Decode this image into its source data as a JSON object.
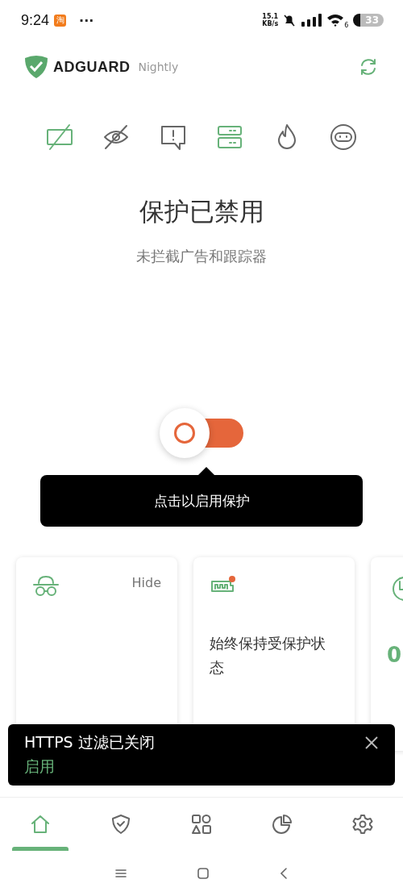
{
  "status_bar": {
    "time": "9:24",
    "app_badge": "淘",
    "more": "···",
    "speed_value": "15.1",
    "speed_unit": "KB/s",
    "wifi_band": "6",
    "battery": "33"
  },
  "header": {
    "brand": "ADGUARD",
    "edition": "Nightly"
  },
  "feature_icons": [
    {
      "kind": "ads",
      "on": true
    },
    {
      "kind": "tracking",
      "on": false
    },
    {
      "kind": "annoyance",
      "on": false
    },
    {
      "kind": "dns",
      "on": true
    },
    {
      "kind": "firewall",
      "on": false
    },
    {
      "kind": "stealth",
      "on": false
    }
  ],
  "status": {
    "title": "保护已禁用",
    "subtitle": "未拦截广告和跟踪器"
  },
  "protection_toggle": {
    "on": false
  },
  "tooltip": {
    "text": "点击以启用保护"
  },
  "cards": [
    {
      "kind": "stealth",
      "action": "Hide"
    },
    {
      "kind": "battery",
      "text": "始终保持受保护状态"
    },
    {
      "kind": "stats",
      "value": "0"
    }
  ],
  "snackbar": {
    "message": "HTTPS 过滤已关闭",
    "action": "启用"
  },
  "bottom_nav": [
    {
      "kind": "home",
      "selected": true
    },
    {
      "kind": "protection",
      "selected": false
    },
    {
      "kind": "apps",
      "selected": false
    },
    {
      "kind": "stats",
      "selected": false
    },
    {
      "kind": "settings",
      "selected": false
    }
  ],
  "system_nav": [
    {
      "kind": "menu"
    },
    {
      "kind": "home"
    },
    {
      "kind": "back"
    }
  ]
}
